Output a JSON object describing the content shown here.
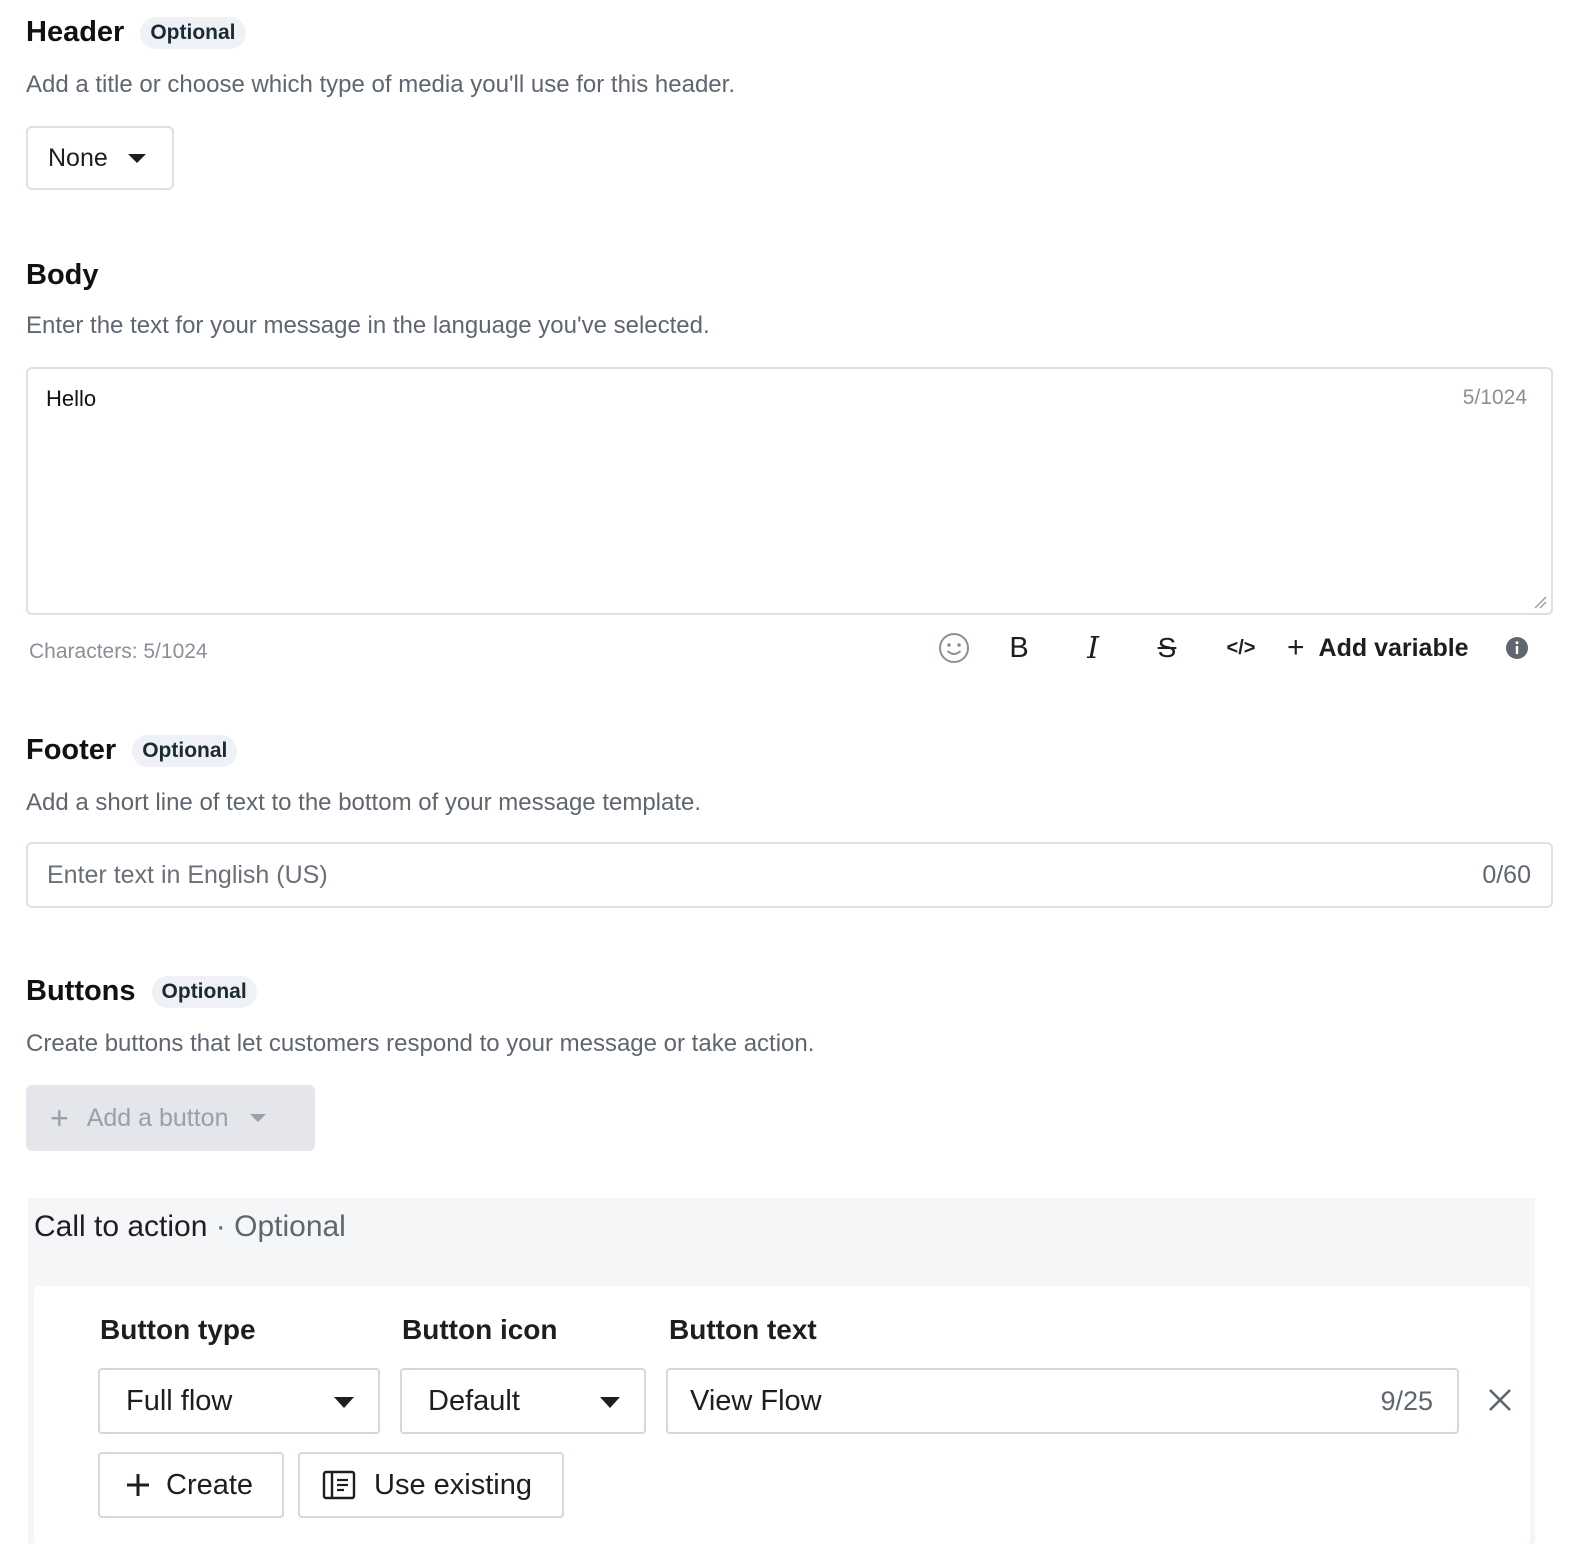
{
  "header": {
    "title": "Header",
    "badge": "Optional",
    "description": "Add a title or choose which type of media you'll use for this header.",
    "media_select": "None"
  },
  "body": {
    "title": "Body",
    "description": "Enter the text for your message in the language you've selected.",
    "text": "Hello",
    "counter": "5/1024",
    "characters": "Characters: 5/1024",
    "toolbar": {
      "emoji_icon": "smiley-icon",
      "bold": "B",
      "italic": "I",
      "strike": "S",
      "code": "</>",
      "add_variable": "Add variable",
      "info_icon": "info-icon"
    }
  },
  "footer": {
    "title": "Footer",
    "badge": "Optional",
    "description": "Add a short line of text to the bottom of your message template.",
    "placeholder": "Enter text in English (US)",
    "counter": "0/60"
  },
  "buttons": {
    "title": "Buttons",
    "badge": "Optional",
    "description": "Create buttons that let customers respond to your message or take action.",
    "add_button": "Add a button"
  },
  "call_to_action": {
    "title": "Call to action",
    "separator": " · ",
    "optional": "Optional",
    "labels": {
      "button_type": "Button type",
      "button_icon": "Button icon",
      "button_text": "Button text"
    },
    "button_type": "Full flow",
    "button_icon": "Default",
    "button_text": "View Flow",
    "button_text_counter": "9/25",
    "create": "Create",
    "use_existing": "Use existing"
  }
}
